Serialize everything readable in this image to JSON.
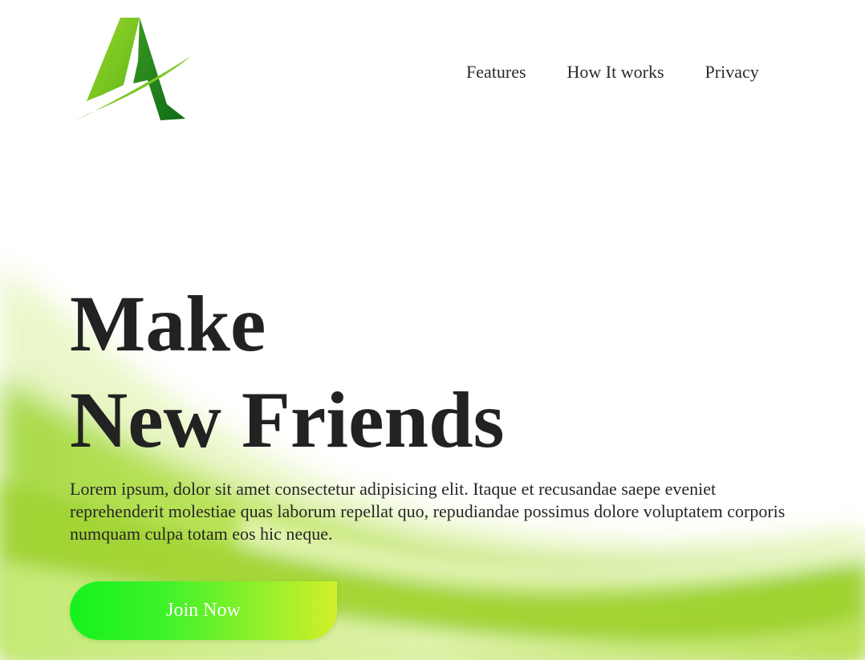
{
  "header": {
    "logo_icon": "letter-a-logo-icon",
    "nav": [
      {
        "label": "Features"
      },
      {
        "label": "How It works"
      },
      {
        "label": "Privacy"
      }
    ]
  },
  "hero": {
    "title_line1": "Make",
    "title_line2": "New Friends",
    "description": "Lorem ipsum, dolor sit amet consectetur adipisicing elit. Itaque et recusandae saepe eveniet reprehenderit molestiae quas laborum repellat quo, repudiandae possimus dolore voluptatem corporis numquam culpa totam eos hic neque.",
    "cta_label": "Join Now"
  },
  "colors": {
    "accent_green": "#3ef22a",
    "logo_light": "#7fcf1c",
    "logo_dark": "#157a1c",
    "text": "#222222"
  }
}
